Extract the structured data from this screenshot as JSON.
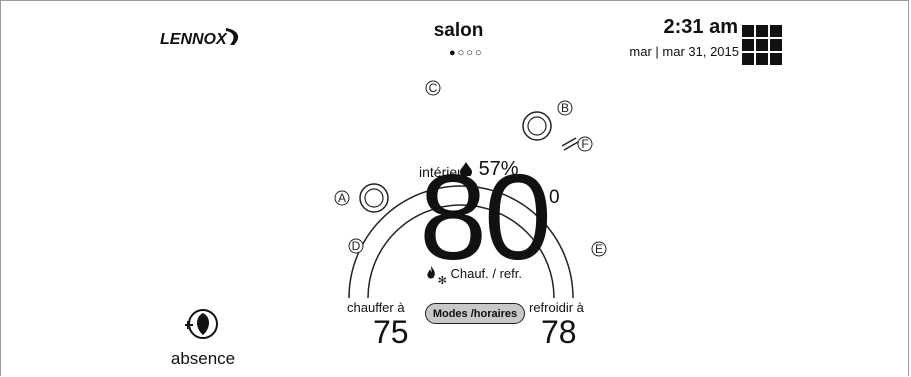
{
  "header": {
    "brand": "LENNOX",
    "room": "salon",
    "pager": "●○○○",
    "time": "2:31 am",
    "date": "mar | mar 31, 2015"
  },
  "dial": {
    "indoor_label": "intérieur",
    "humidity": "57%",
    "indoor_temp": "80",
    "degree_symbol": "0",
    "mode": "Chauf. / refr.",
    "callouts": {
      "a": "A",
      "b": "B",
      "c": "C",
      "d": "D",
      "e": "E",
      "f": "F"
    }
  },
  "setpoints": {
    "heat_label": "chauffer à",
    "heat_value": "75",
    "cool_label": "refroidir à",
    "cool_value": "78",
    "modes_button": "Modes /horaires"
  },
  "away": {
    "label": "absence"
  },
  "icons": {
    "logo": "lennox-logo",
    "grid": "grid-menu-icon",
    "drop": "humidity-drop-icon",
    "flame": "flame-icon",
    "snow": "snowflake-icon",
    "away": "away-leaf-icon"
  }
}
